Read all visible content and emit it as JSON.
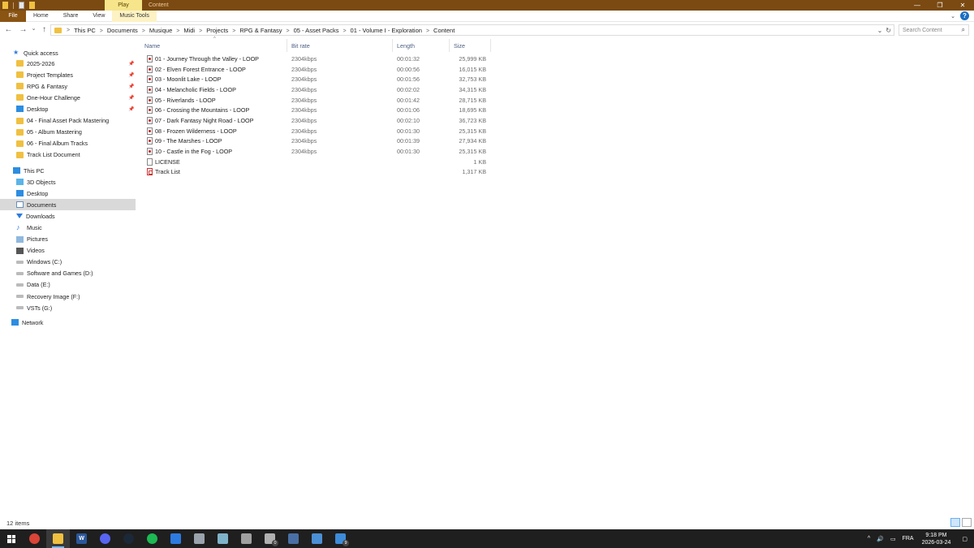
{
  "titlebar": {
    "contextual_tab": "Play",
    "window_title": "Content",
    "minimize_glyph": "—",
    "maximize_glyph": "❐",
    "close_glyph": "✕"
  },
  "ribbon": {
    "tabs": [
      "File",
      "Home",
      "Share",
      "View",
      "Music Tools"
    ],
    "help_glyph": "?",
    "expand_glyph": "⌄"
  },
  "nav": {
    "back_glyph": "←",
    "forward_glyph": "→",
    "recent_glyph": "⌄",
    "up_glyph": "↑"
  },
  "breadcrumbs": [
    "This PC",
    "Documents",
    "Musique",
    "Midi",
    "Projects",
    "RPG & Fantasy",
    "05 - Asset Packs",
    "01 - Volume I - Exploration",
    "Content"
  ],
  "breadcrumb_sep": ">",
  "address_end": {
    "dropdown_glyph": "⌄",
    "refresh_glyph": "↻"
  },
  "search": {
    "placeholder": "Search Content",
    "icon": "search-icon",
    "glyph": "⌕"
  },
  "sidebar": {
    "pin_glyph": "📌",
    "quick_access": {
      "label": "Quick access",
      "items": [
        {
          "label": "2025-2026",
          "pinned": true,
          "icon": "folder-icon"
        },
        {
          "label": "Project Templates",
          "pinned": true,
          "icon": "folder-icon"
        },
        {
          "label": "RPG & Fantasy",
          "pinned": true,
          "icon": "folder-icon"
        },
        {
          "label": "One-Hour Challenge",
          "pinned": true,
          "icon": "folder-icon"
        },
        {
          "label": "Desktop",
          "pinned": true,
          "icon": "desktop-icon"
        },
        {
          "label": "04 - Final Asset Pack Mastering",
          "pinned": false,
          "icon": "folder-icon"
        },
        {
          "label": "05 - Album Mastering",
          "pinned": false,
          "icon": "folder-icon"
        },
        {
          "label": "06 - Final Album Tracks",
          "pinned": false,
          "icon": "folder-icon"
        },
        {
          "label": "Track List Document",
          "pinned": false,
          "icon": "folder-icon"
        }
      ]
    },
    "this_pc": {
      "label": "This PC",
      "items": [
        {
          "label": "3D Objects",
          "icon": "3d-objects-icon"
        },
        {
          "label": "Desktop",
          "icon": "desktop-icon"
        },
        {
          "label": "Documents",
          "icon": "documents-icon",
          "selected": true
        },
        {
          "label": "Downloads",
          "icon": "downloads-icon"
        },
        {
          "label": "Music",
          "icon": "music-icon"
        },
        {
          "label": "Pictures",
          "icon": "pictures-icon"
        },
        {
          "label": "Videos",
          "icon": "videos-icon"
        },
        {
          "label": "Windows (C:)",
          "icon": "drive-icon"
        },
        {
          "label": "Software and Games (D:)",
          "icon": "drive-icon"
        },
        {
          "label": "Data (E:)",
          "icon": "drive-icon"
        },
        {
          "label": "Recovery Image (F:)",
          "icon": "drive-icon"
        },
        {
          "label": "VSTs (G:)",
          "icon": "drive-icon"
        }
      ]
    },
    "network": {
      "label": "Network",
      "icon": "network-icon"
    }
  },
  "columns": {
    "name": "Name",
    "bitrate": "Bit rate",
    "length": "Length",
    "size": "Size",
    "sort_glyph": "^"
  },
  "files": [
    {
      "name": "01 - Journey Through the Valley - LOOP",
      "bitrate": "2304kbps",
      "length": "00:01:32",
      "size": "25,999 KB",
      "type": "audio"
    },
    {
      "name": "02 - Elven Forest Entrance - LOOP",
      "bitrate": "2304kbps",
      "length": "00:00:56",
      "size": "16,015 KB",
      "type": "audio"
    },
    {
      "name": "03 - Moonlit Lake - LOOP",
      "bitrate": "2304kbps",
      "length": "00:01:56",
      "size": "32,753 KB",
      "type": "audio"
    },
    {
      "name": "04 - Melancholic Fields - LOOP",
      "bitrate": "2304kbps",
      "length": "00:02:02",
      "size": "34,315 KB",
      "type": "audio"
    },
    {
      "name": "05 - Riverlands - LOOP",
      "bitrate": "2304kbps",
      "length": "00:01:42",
      "size": "28,715 KB",
      "type": "audio"
    },
    {
      "name": "06 - Crossing the Mountains - LOOP",
      "bitrate": "2304kbps",
      "length": "00:01:06",
      "size": "18,695 KB",
      "type": "audio"
    },
    {
      "name": "07 - Dark Fantasy Night Road - LOOP",
      "bitrate": "2304kbps",
      "length": "00:02:10",
      "size": "36,723 KB",
      "type": "audio"
    },
    {
      "name": "08 - Frozen Wilderness - LOOP",
      "bitrate": "2304kbps",
      "length": "00:01:30",
      "size": "25,315 KB",
      "type": "audio"
    },
    {
      "name": "09 - The Marshes - LOOP",
      "bitrate": "2304kbps",
      "length": "00:01:39",
      "size": "27,934 KB",
      "type": "audio"
    },
    {
      "name": "10 - Castle in the Fog - LOOP",
      "bitrate": "2304kbps",
      "length": "00:01:30",
      "size": "25,315 KB",
      "type": "audio"
    },
    {
      "name": "LICENSE",
      "bitrate": "",
      "length": "",
      "size": "1 KB",
      "type": "text"
    },
    {
      "name": "Track List",
      "bitrate": "",
      "length": "",
      "size": "1,317 KB",
      "type": "pdf"
    }
  ],
  "status": {
    "item_count": "12 items"
  },
  "taskbar": {
    "apps": [
      {
        "name": "chrome",
        "color": "#db4437",
        "glyph": ""
      },
      {
        "name": "file-explorer",
        "color": "#f0c040",
        "glyph": "",
        "active": true
      },
      {
        "name": "word",
        "color": "#2b579a",
        "glyph": "W"
      },
      {
        "name": "discord",
        "color": "#5865f2",
        "glyph": ""
      },
      {
        "name": "steam",
        "color": "#1b2838",
        "glyph": ""
      },
      {
        "name": "spotify",
        "color": "#1db954",
        "glyph": ""
      },
      {
        "name": "app-blue-bar",
        "color": "#2d7be0",
        "glyph": ""
      },
      {
        "name": "app-gray-1",
        "color": "#9aa3ad",
        "glyph": ""
      },
      {
        "name": "app-gray-2",
        "color": "#7fb3c9",
        "glyph": ""
      },
      {
        "name": "app-gray-3",
        "color": "#a0a0a0",
        "glyph": ""
      },
      {
        "name": "app-badge-0",
        "color": "#b0b0b0",
        "glyph": "",
        "badge": "0"
      },
      {
        "name": "calculator",
        "color": "#4a6fa5",
        "glyph": ""
      },
      {
        "name": "app-blue-2",
        "color": "#4b8fd6",
        "glyph": ""
      },
      {
        "name": "app-badge-9",
        "color": "#3d8bd9",
        "glyph": "",
        "badge": "9"
      }
    ],
    "tray": {
      "language": "FRA",
      "time": "9:18 PM",
      "date": "2026-03-24",
      "up_glyph": "^",
      "volume_glyph": "🔊",
      "network_glyph": "▭",
      "notification_glyph": "▢"
    }
  }
}
